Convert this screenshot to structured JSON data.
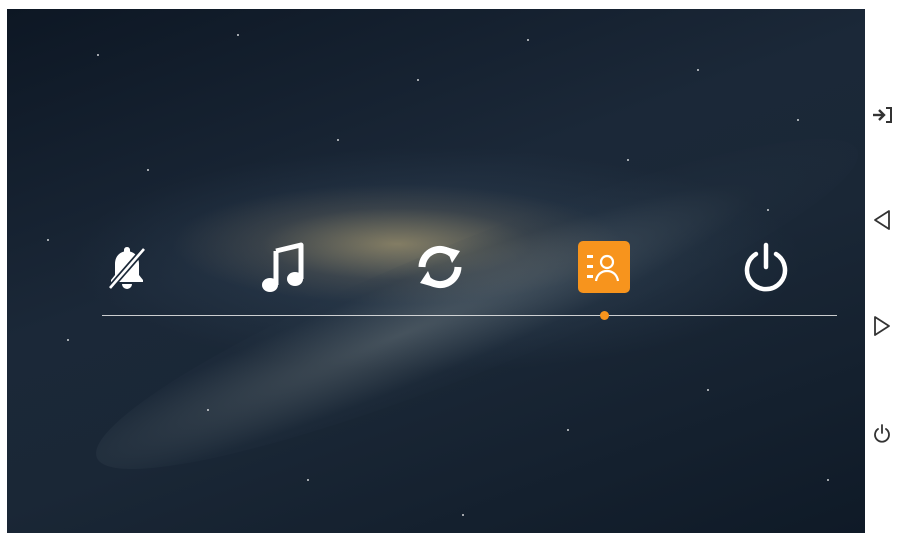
{
  "menu": {
    "items": [
      {
        "icon": "bell-off-icon"
      },
      {
        "icon": "music-note-icon"
      },
      {
        "icon": "sync-icon"
      },
      {
        "icon": "contacts-icon",
        "selected": true
      },
      {
        "icon": "power-icon"
      }
    ],
    "selected_index": 3
  },
  "side_panel": {
    "buttons": [
      {
        "icon": "enter-icon"
      },
      {
        "icon": "triangle-left-icon"
      },
      {
        "icon": "triangle-right-icon"
      },
      {
        "icon": "power-icon"
      }
    ]
  },
  "colors": {
    "accent": "#f7941d",
    "icon": "#ffffff",
    "side_icon": "#333333"
  }
}
